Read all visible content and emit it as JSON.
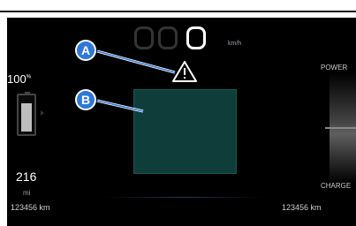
{
  "speed": {
    "unit": "km/h"
  },
  "battery": {
    "percent_value": "100",
    "percent_sign": "%",
    "level": 0.85
  },
  "range": {
    "value": "216",
    "unit": "mi"
  },
  "odometer": {
    "left": "123456 km",
    "right": "123456 km"
  },
  "power_gauge": {
    "top_label": "POWER",
    "bottom_label": "CHARGE"
  },
  "callouts": {
    "a": "A",
    "b": "B"
  },
  "colors": {
    "screen_bg": "#000000",
    "display_teal": "#0f3e3a",
    "callout_blue": "#2f78d6"
  }
}
